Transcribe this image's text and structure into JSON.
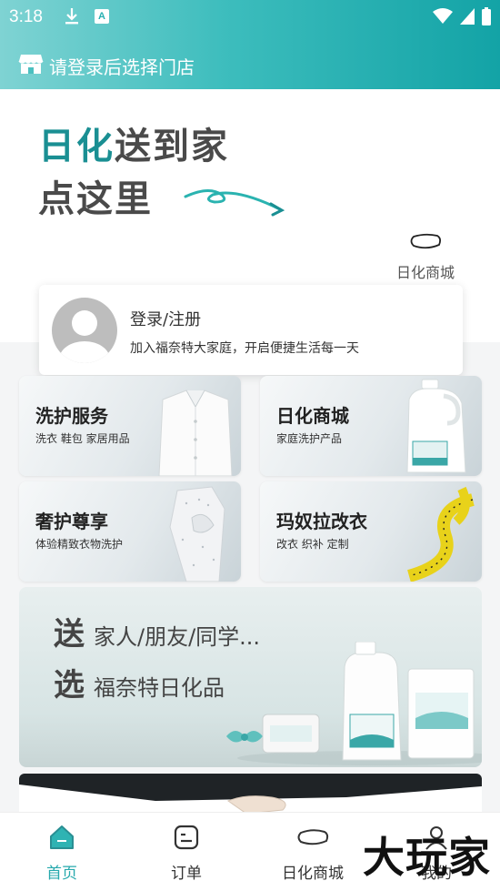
{
  "status_bar": {
    "time": "3:18",
    "notification_icons": [
      "download-icon",
      "app-icon"
    ],
    "system_icons": [
      "wifi-icon",
      "signal-icon",
      "battery-icon"
    ]
  },
  "header": {
    "store_prompt": "请登录后选择门店",
    "icon": "store-icon"
  },
  "hero": {
    "line1_accent": "日化",
    "line1_rest": "送到家",
    "line2": "点这里",
    "corner_label": "日化商城"
  },
  "login_card": {
    "title": "登录/注册",
    "subtitle": "加入福奈特大家庭，开启便捷生活每一天"
  },
  "services": [
    {
      "title": "洗护服务",
      "subtitle": "洗衣 鞋包 家居用品"
    },
    {
      "title": "日化商城",
      "subtitle": "家庭洗护产品"
    },
    {
      "title": "奢护尊享",
      "subtitle": "体验精致衣物洗护"
    },
    {
      "title": "玛奴拉改衣",
      "subtitle": "改衣 织补 定制"
    }
  ],
  "promo": {
    "line1_big": "送",
    "line1_small": "家人/朋友/同学...",
    "line2_big": "选",
    "line2_small": "福奈特日化品"
  },
  "tabs": [
    {
      "label": "首页",
      "active": true
    },
    {
      "label": "订单",
      "active": false
    },
    {
      "label": "日化商城",
      "active": false
    },
    {
      "label": "我的",
      "active": false
    }
  ],
  "watermark": "大玩家",
  "colors": {
    "accent": "#27a9ad",
    "header_start": "#7fd3d3",
    "header_end": "#13a3a6"
  }
}
